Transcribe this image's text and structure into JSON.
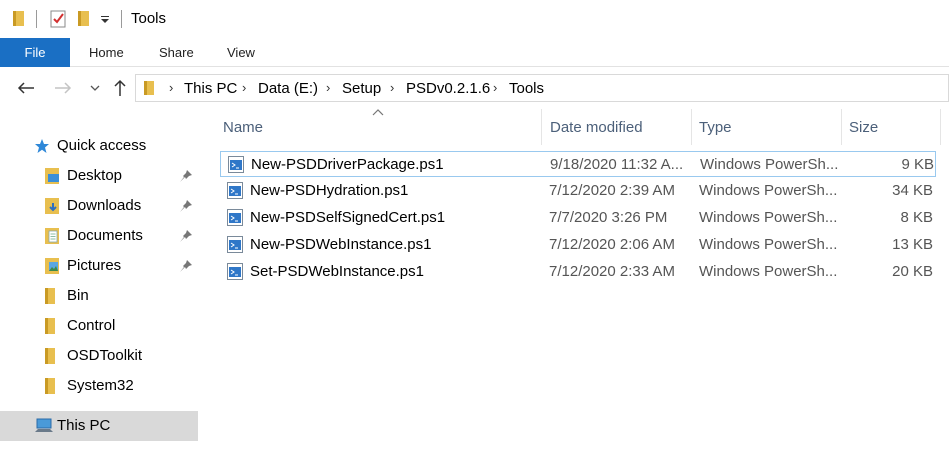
{
  "window": {
    "title": "Tools"
  },
  "ribbon": {
    "tabs": [
      "File",
      "Home",
      "Share",
      "View"
    ]
  },
  "address": {
    "crumbs": [
      "This PC",
      "Data (E:)",
      "Setup",
      "PSDv0.2.1.6",
      "Tools"
    ]
  },
  "nav": {
    "quick_access": "Quick access",
    "items": [
      {
        "label": "Desktop",
        "pinned": true
      },
      {
        "label": "Downloads",
        "pinned": true
      },
      {
        "label": "Documents",
        "pinned": true
      },
      {
        "label": "Pictures",
        "pinned": true
      },
      {
        "label": "Bin",
        "pinned": false
      },
      {
        "label": "Control",
        "pinned": false
      },
      {
        "label": "OSDToolkit",
        "pinned": false
      },
      {
        "label": "System32",
        "pinned": false
      }
    ],
    "this_pc": "This PC"
  },
  "columns": {
    "name": "Name",
    "date": "Date modified",
    "type": "Type",
    "size": "Size"
  },
  "files": [
    {
      "name": "New-PSDDriverPackage.ps1",
      "date": "9/18/2020 11:32 A...",
      "type": "Windows PowerSh...",
      "size": "9 KB"
    },
    {
      "name": "New-PSDHydration.ps1",
      "date": "7/12/2020 2:39 AM",
      "type": "Windows PowerSh...",
      "size": "34 KB"
    },
    {
      "name": "New-PSDSelfSignedCert.ps1",
      "date": "7/7/2020 3:26 PM",
      "type": "Windows PowerSh...",
      "size": "8 KB"
    },
    {
      "name": "New-PSDWebInstance.ps1",
      "date": "7/12/2020 2:06 AM",
      "type": "Windows PowerSh...",
      "size": "13 KB"
    },
    {
      "name": "Set-PSDWebInstance.ps1",
      "date": "7/12/2020 2:33 AM",
      "type": "Windows PowerSh...",
      "size": "20 KB"
    }
  ],
  "colors": {
    "file_tab": "#1a6fc4",
    "folder": "#e8bf4f",
    "header_text": "#4c607a",
    "selection_border": "#99c9ef",
    "nav_selected": "#d9d9d9"
  }
}
